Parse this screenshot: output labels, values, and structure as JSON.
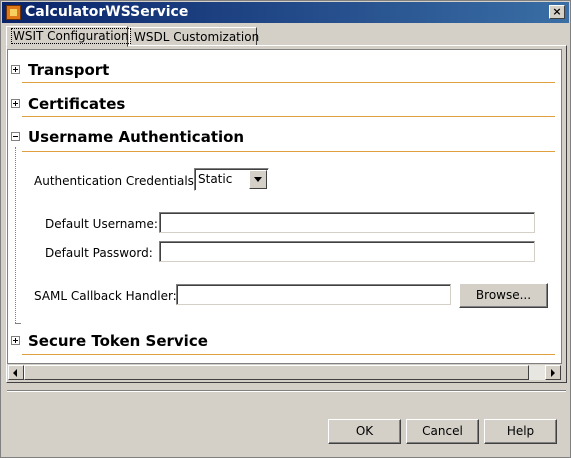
{
  "window": {
    "title": "CalculatorWSService",
    "icon": "app-icon",
    "close_symbol": "×"
  },
  "tabs": [
    {
      "label": "WSIT Configuration",
      "active": true
    },
    {
      "label": "WSDL Customization",
      "active": false
    }
  ],
  "sections": {
    "transport": {
      "title": "Transport",
      "expanded": false
    },
    "certificates": {
      "title": "Certificates",
      "expanded": false
    },
    "username_auth": {
      "title": "Username Authentication",
      "expanded": true
    },
    "secure_token": {
      "title": "Secure Token Service",
      "expanded": false
    }
  },
  "username_auth": {
    "credentials_label": "Authentication Credentials:",
    "credentials_value": "Static",
    "username_label": "Default Username:",
    "username_value": "",
    "password_label": "Default Password:",
    "password_value": "",
    "saml_label": "SAML Callback Handler:",
    "saml_value": "",
    "browse_label": "Browse..."
  },
  "footer": {
    "ok_label": "OK",
    "cancel_label": "Cancel",
    "help_label": "Help"
  },
  "colors": {
    "titlebar": "#0a246a",
    "section_rule": "#e0a040",
    "face": "#d4d0c8"
  }
}
